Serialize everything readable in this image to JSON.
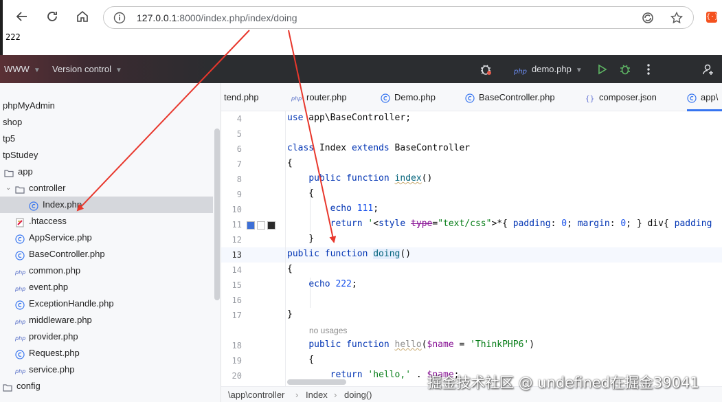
{
  "browser": {
    "url_host": "127.0.0.1",
    "url_rest": ":8000/index.php/index/doing",
    "page_output": "222",
    "ext_badge": "{·}"
  },
  "ide": {
    "project": "WWW",
    "vcs": "Version control",
    "run_config": "demo.php"
  },
  "tree": {
    "items": [
      {
        "label": "phpMyAdmin",
        "icon": "none"
      },
      {
        "label": "shop",
        "icon": "none"
      },
      {
        "label": "tp5",
        "icon": "none"
      },
      {
        "label": "tpStudey",
        "icon": "none"
      },
      {
        "label": "app",
        "icon": "folder-icon"
      },
      {
        "label": "controller",
        "icon": "folder-icon"
      },
      {
        "label": "Index.php",
        "icon": "class-icon"
      },
      {
        "label": ".htaccess",
        "icon": "config-file-icon"
      },
      {
        "label": "AppService.php",
        "icon": "class-icon"
      },
      {
        "label": "BaseController.php",
        "icon": "class-icon"
      },
      {
        "label": "common.php",
        "icon": "php-file-icon"
      },
      {
        "label": "event.php",
        "icon": "php-file-icon"
      },
      {
        "label": "ExceptionHandle.php",
        "icon": "class-icon"
      },
      {
        "label": "middleware.php",
        "icon": "php-file-icon"
      },
      {
        "label": "provider.php",
        "icon": "php-file-icon"
      },
      {
        "label": "Request.php",
        "icon": "class-icon"
      },
      {
        "label": "service.php",
        "icon": "php-file-icon"
      },
      {
        "label": "config",
        "icon": "folder-icon"
      }
    ]
  },
  "tabs": [
    {
      "label": "tend.php",
      "icon": "none"
    },
    {
      "label": "router.php",
      "icon": "php-file-icon"
    },
    {
      "label": "Demo.php",
      "icon": "class-icon"
    },
    {
      "label": "BaseController.php",
      "icon": "class-icon"
    },
    {
      "label": "composer.json",
      "icon": "json-icon"
    },
    {
      "label": "app\\",
      "icon": "class-icon"
    }
  ],
  "editor": {
    "line_numbers": [
      "4",
      "5",
      "6",
      "7",
      "8",
      "9",
      "10",
      "11",
      "12",
      "13",
      "14",
      "15",
      "16",
      "17",
      "18",
      "19",
      "20"
    ],
    "hint_no_usages": "no usages",
    "swatch_colors": [
      "#3d6fd6",
      "#ffffff",
      "#2b2b2b"
    ]
  },
  "breadcrumbs": [
    "\\app\\controller",
    "Index",
    "doing()"
  ],
  "watermark": "掘金技术社区 @ undefined在掘金39041",
  "colors": {
    "accent": "#3574f0",
    "arrow": "#e8372c",
    "ide_header": "#2b2d30"
  }
}
